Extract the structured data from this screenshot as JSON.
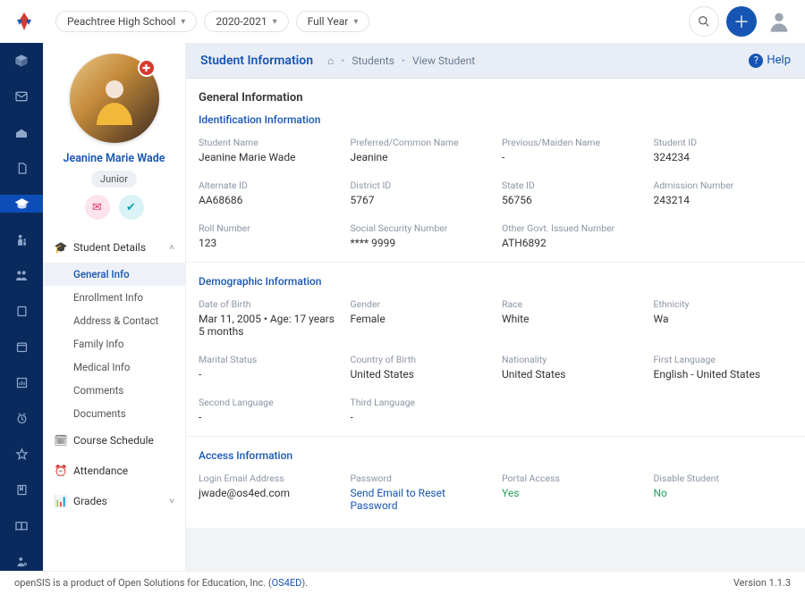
{
  "topbar": {
    "school": "Peachtree High School",
    "year": "2020-2021",
    "term": "Full Year"
  },
  "breadcrumb": {
    "page_title": "Student Information",
    "items": [
      "Students",
      "View Student"
    ],
    "help_label": "Help"
  },
  "profile": {
    "name": "Jeanine Marie Wade",
    "grade": "Junior"
  },
  "submenu": {
    "details_label": "Student Details",
    "items": [
      {
        "label": "General Info",
        "active": true
      },
      {
        "label": "Enrollment Info"
      },
      {
        "label": "Address & Contact"
      },
      {
        "label": "Family Info"
      },
      {
        "label": "Medical Info"
      },
      {
        "label": "Comments"
      },
      {
        "label": "Documents"
      }
    ],
    "course_schedule": "Course Schedule",
    "attendance": "Attendance",
    "grades": "Grades"
  },
  "general": {
    "card_title": "General Information",
    "identification": {
      "section_title": "Identification Information",
      "student_name_label": "Student Name",
      "student_name": "Jeanine Marie Wade",
      "preferred_label": "Preferred/Common Name",
      "preferred": "Jeanine",
      "maiden_label": "Previous/Maiden Name",
      "maiden": "-",
      "student_id_label": "Student ID",
      "student_id": "324234",
      "alt_id_label": "Alternate ID",
      "alt_id": "AA68686",
      "district_id_label": "District ID",
      "district_id": "5767",
      "state_id_label": "State ID",
      "state_id": "56756",
      "admission_label": "Admission Number",
      "admission": "243214",
      "roll_label": "Roll Number",
      "roll": "123",
      "ssn_label": "Social Security Number",
      "ssn": "**** 9999",
      "govt_label": "Other Govt. Issued Number",
      "govt": "ATH6892"
    },
    "demographic": {
      "section_title": "Demographic Information",
      "dob_label": "Date of Birth",
      "dob_value": "Mar 11, 2005   •   Age: 17 years 5 months",
      "gender_label": "Gender",
      "gender": "Female",
      "race_label": "Race",
      "race": "White",
      "ethnicity_label": "Ethnicity",
      "ethnicity": "Wa",
      "marital_label": "Marital Status",
      "marital": "-",
      "cob_label": "Country of Birth",
      "cob": "United States",
      "nationality_label": "Nationality",
      "nationality": "United States",
      "lang1_label": "First Language",
      "lang1": "English - United States",
      "lang2_label": "Second Language",
      "lang2": "-",
      "lang3_label": "Third Language",
      "lang3": "-"
    },
    "access": {
      "section_title": "Access Information",
      "email_label": "Login Email Address",
      "email": "jwade@os4ed.com",
      "password_label": "Password",
      "password_action": "Send Email to Reset Password",
      "portal_label": "Portal Access",
      "portal": "Yes",
      "disable_label": "Disable Student",
      "disable": "No"
    }
  },
  "footer": {
    "text_prefix": "openSIS is a product of Open Solutions for Education, Inc. (",
    "link": "OS4ED",
    "text_suffix": ").",
    "version": "Version 1.1.3"
  }
}
